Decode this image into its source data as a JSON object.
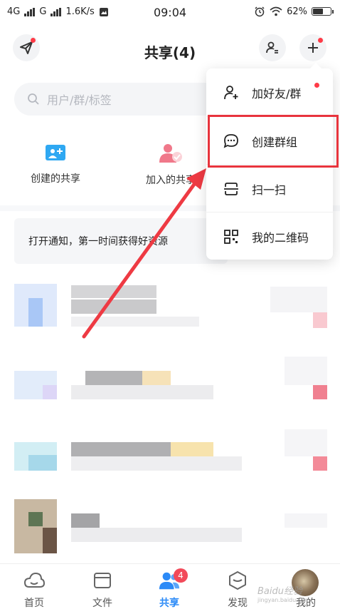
{
  "status": {
    "network1": "4G",
    "network2": "G",
    "speed": "1.6K/s",
    "time": "09:04",
    "battery": "62%",
    "battery_level": 0.62
  },
  "header": {
    "title": "共享(4)"
  },
  "search": {
    "placeholder": "用户/群/标签"
  },
  "quick_actions": [
    {
      "label": "创建的共享"
    },
    {
      "label": "加入的共享"
    }
  ],
  "notice": {
    "text": "打开通知，第一时间获得好资源"
  },
  "menu": {
    "items": [
      {
        "label": "加好友/群"
      },
      {
        "label": "创建群组"
      },
      {
        "label": "扫一扫"
      },
      {
        "label": "我的二维码"
      }
    ]
  },
  "tabs": [
    {
      "label": "首页"
    },
    {
      "label": "文件"
    },
    {
      "label": "共享",
      "badge": "4"
    },
    {
      "label": "发现"
    },
    {
      "label": "我的"
    }
  ],
  "watermark": {
    "brand": "Baidu经验",
    "url": "jingyan.baidu.com"
  },
  "colors": {
    "accent": "#2b8af7",
    "badge": "#f24a5a",
    "highlight": "#e8343d"
  }
}
